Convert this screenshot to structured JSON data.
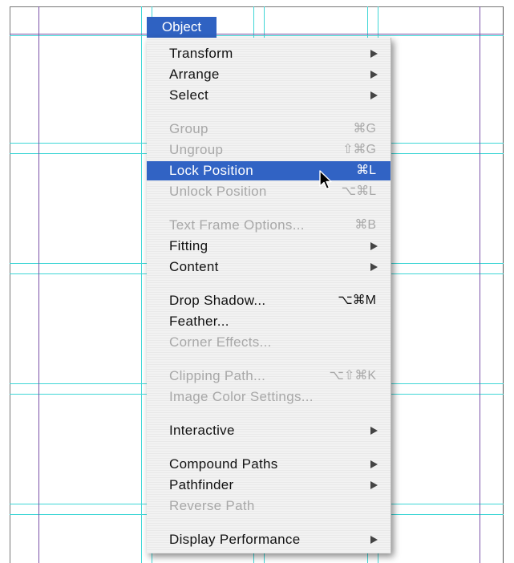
{
  "menu_bar": {
    "title": "Object"
  },
  "menu": {
    "items": [
      {
        "label": "Transform",
        "shortcut": "",
        "submenu": true,
        "enabled": true
      },
      {
        "label": "Arrange",
        "shortcut": "",
        "submenu": true,
        "enabled": true
      },
      {
        "label": "Select",
        "shortcut": "",
        "submenu": true,
        "enabled": true
      },
      {
        "label": "Group",
        "shortcut": "⌘G",
        "submenu": false,
        "enabled": false
      },
      {
        "label": "Ungroup",
        "shortcut": "⇧⌘G",
        "submenu": false,
        "enabled": false
      },
      {
        "label": "Lock Position",
        "shortcut": "⌘L",
        "submenu": false,
        "enabled": true,
        "highlighted": true
      },
      {
        "label": "Unlock Position",
        "shortcut": "⌥⌘L",
        "submenu": false,
        "enabled": false
      },
      {
        "label": "Text Frame Options...",
        "shortcut": "⌘B",
        "submenu": false,
        "enabled": false
      },
      {
        "label": "Fitting",
        "shortcut": "",
        "submenu": true,
        "enabled": true
      },
      {
        "label": "Content",
        "shortcut": "",
        "submenu": true,
        "enabled": true
      },
      {
        "label": "Drop Shadow...",
        "shortcut": "⌥⌘M",
        "submenu": false,
        "enabled": true
      },
      {
        "label": "Feather...",
        "shortcut": "",
        "submenu": false,
        "enabled": true
      },
      {
        "label": "Corner Effects...",
        "shortcut": "",
        "submenu": false,
        "enabled": false
      },
      {
        "label": "Clipping Path...",
        "shortcut": "⌥⇧⌘K",
        "submenu": false,
        "enabled": false
      },
      {
        "label": "Image Color Settings...",
        "shortcut": "",
        "submenu": false,
        "enabled": false
      },
      {
        "label": "Interactive",
        "shortcut": "",
        "submenu": true,
        "enabled": true
      },
      {
        "label": "Compound Paths",
        "shortcut": "",
        "submenu": true,
        "enabled": true
      },
      {
        "label": "Pathfinder",
        "shortcut": "",
        "submenu": true,
        "enabled": true
      },
      {
        "label": "Reverse Path",
        "shortcut": "",
        "submenu": false,
        "enabled": false
      },
      {
        "label": "Display Performance",
        "shortcut": "",
        "submenu": true,
        "enabled": true
      }
    ]
  },
  "colors": {
    "highlight": "#3163c4",
    "guide": "#3fd6d6",
    "margin": "#7a52a8",
    "disabled_text": "#a8a8a8"
  }
}
